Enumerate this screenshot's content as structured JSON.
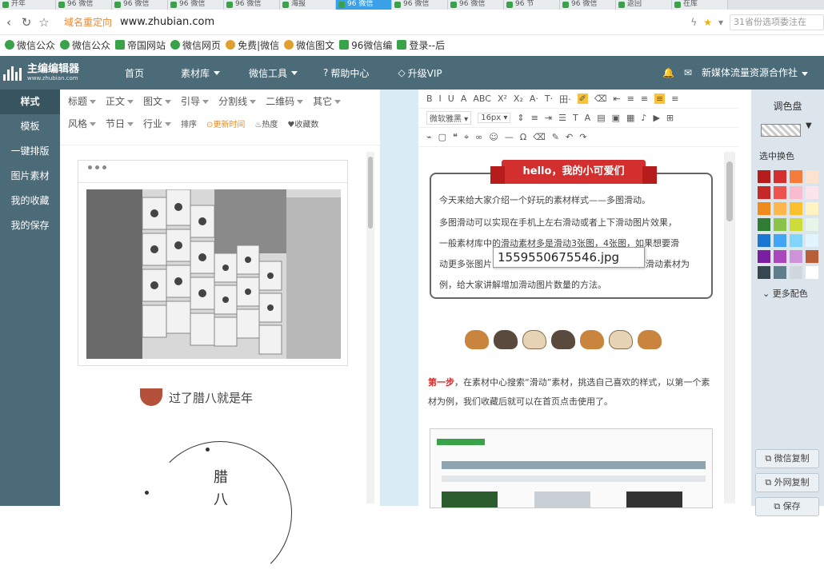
{
  "tabs": [
    {
      "label": "开年"
    },
    {
      "label": "96 微信"
    },
    {
      "label": "96 微信"
    },
    {
      "label": "96 微信"
    },
    {
      "label": "96 微信"
    },
    {
      "label": "海报"
    },
    {
      "label": "96 微信",
      "active": true
    },
    {
      "label": "96 微信"
    },
    {
      "label": "96 微信"
    },
    {
      "label": "96 节"
    },
    {
      "label": "96 微信"
    },
    {
      "label": "返回"
    },
    {
      "label": "在库"
    }
  ],
  "addr": {
    "site_tag": "域名重定向",
    "url": "www.zhubian.com",
    "search_placeholder": "31省份选项委注在"
  },
  "bookmarks": [
    {
      "label": "微信公众",
      "icon": "chart-icon"
    },
    {
      "label": "微信公众",
      "icon": "wechat-icon"
    },
    {
      "label": "帝国网站",
      "icon": "96-icon"
    },
    {
      "label": "微信网页",
      "icon": "wechat-icon"
    },
    {
      "label": "免费|微信",
      "icon": "scissors-icon"
    },
    {
      "label": "微信图文",
      "icon": "circle-icon"
    },
    {
      "label": "96微信编",
      "icon": "96-icon"
    },
    {
      "label": "登录--后",
      "icon": "96-icon"
    }
  ],
  "topnav": {
    "logo_title": "主编编辑器",
    "logo_sub": "www.zhubian.com",
    "items": [
      "首页",
      "素材库",
      "微信工具",
      "帮助中心",
      "升级VIP"
    ],
    "right_text": "新媒体流量资源合作社"
  },
  "sidebar": [
    "样式",
    "模板",
    "一键排版",
    "图片素材",
    "我的收藏",
    "我的保存"
  ],
  "categories": {
    "row1": [
      "标题",
      "正文",
      "图文",
      "引导",
      "分割线",
      "二维码",
      "其它"
    ],
    "row2": [
      "风格",
      "节日",
      "行业"
    ],
    "sort": "排序",
    "newest": "更新时间",
    "hot": "热度",
    "fav": "收藏数"
  },
  "left": {
    "laba_text": "过了腊八就是年",
    "vertical": [
      "腊",
      "八"
    ]
  },
  "toolbar": {
    "row1": [
      "B",
      "I",
      "U",
      "A",
      "ABC",
      "X²",
      "X₂",
      "A·",
      "T·",
      "田·"
    ],
    "font": "微软雅黑",
    "size": "16px"
  },
  "article": {
    "ribbon": "hello，我的小可爱们",
    "lines": [
      "今天来给大家介绍一个好玩的素材样式——多图滑动。",
      "多图滑动可以实现在手机上左右滑动或者上下滑动图片效果，",
      "一般素材库中的滑动素材多是滑动3张图，4张图，如果想要滑",
      "动更多张图片，",
      "例，给大家讲解增加滑动图片数量的方法。"
    ],
    "line4_tail": "右滑动素材为",
    "tooltip": "1559550675546.jpg",
    "step_label": "第一步",
    "step_text": "，在素材中心搜索“滑动”素材，挑选自己喜欢的样式，以第一个素材为例，我们收藏后就可以在首页点击使用了。"
  },
  "palette": {
    "title": "调色盘",
    "sub": "选中换色",
    "more": "更多配色",
    "colors": [
      "#b71c1c",
      "#d32f2f",
      "#f57c3a",
      "#fbe3d0",
      "#c62828",
      "#ef5350",
      "#f8bbd0",
      "#fce4ec",
      "#ef8a1c",
      "#ffb74d",
      "#fbc02d",
      "#fff3c4",
      "#2e7d32",
      "#8bc34a",
      "#cddc39",
      "#e8f5e9",
      "#1976d2",
      "#42a5f5",
      "#81d4fa",
      "#e1f5fe",
      "#7b1fa2",
      "#ab47bc",
      "#ce93d8",
      "#b85f3a",
      "#37474f",
      "#607d8b",
      "#cfd8dc",
      "#ffffff"
    ],
    "copy_wechat": "微信复制",
    "copy_external": "外网复制",
    "copy_third": "保存"
  }
}
